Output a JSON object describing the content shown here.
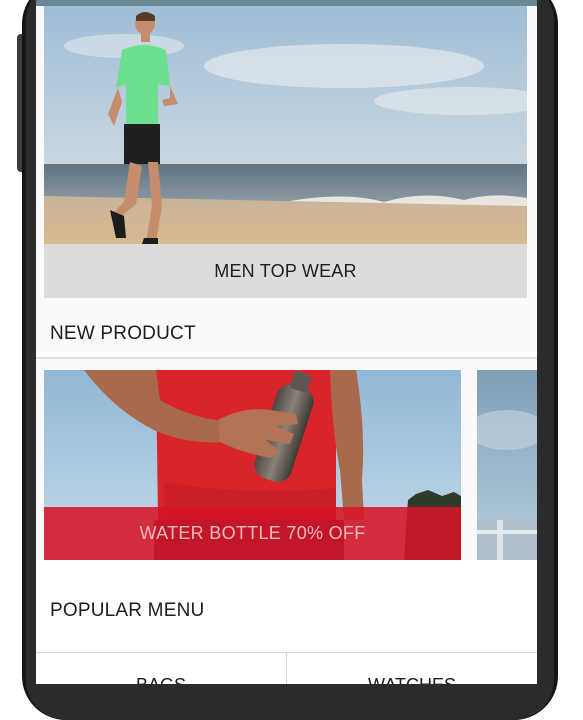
{
  "hero": {
    "caption": "MEN TOP WEAR"
  },
  "new_product": {
    "title": "NEW PRODUCT",
    "items": [
      {
        "label": "WATER BOTTLE 70% OFF"
      }
    ]
  },
  "popular_menu": {
    "title": "POPULAR MENU",
    "items": [
      {
        "label": "BAGS"
      },
      {
        "label": "WATCHES"
      }
    ]
  },
  "colors": {
    "topbar": "#6a8796",
    "caption_bg": "#dcdcdc",
    "promo_banner": "#d61428",
    "promo_text": "#f2b9bf"
  }
}
